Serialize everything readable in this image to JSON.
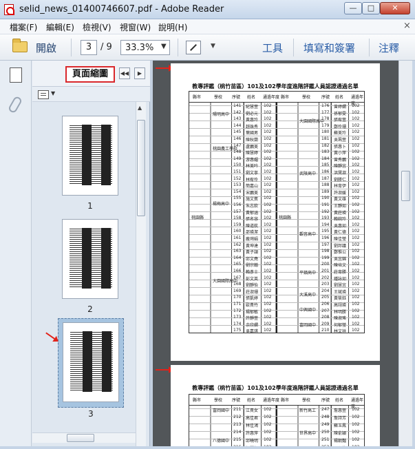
{
  "window": {
    "title": "selid_news_01400746607.pdf - Adobe Reader",
    "min": "—",
    "max": "□",
    "close": "✕"
  },
  "menu": [
    {
      "label": "檔案(F)"
    },
    {
      "label": "編輯(E)"
    },
    {
      "label": "檢視(V)"
    },
    {
      "label": "視窗(W)"
    },
    {
      "label": "說明(H)"
    }
  ],
  "menu_close": "×",
  "toolbar": {
    "open_label": "開啟",
    "page_value": "3",
    "page_total": "/ 9",
    "zoom_value": "33.3%",
    "zoom_arrow": "▼",
    "more_arrow": "▼",
    "tools_label": "工具",
    "fill_sign_label": "填寫和簽署",
    "comment_label": "注釋"
  },
  "panel": {
    "title": "頁面縮圖",
    "prev": "◀◀",
    "next": "▶",
    "options_arrow": "▼",
    "thumbnails": [
      {
        "label": "1"
      },
      {
        "label": "2"
      },
      {
        "label": "3"
      }
    ],
    "scroll_up": "▲",
    "scroll_down": "▼"
  },
  "document": {
    "page_title": "教專評鑑（桃竹苗區）101及102學年度進階評鑑人員認證通過名單",
    "headers": [
      "縣市",
      "學校",
      "序號",
      "姓名",
      "通過年度",
      "縣市",
      "學校",
      "序號",
      "姓名",
      "通過年度"
    ],
    "left_county": "桃園縣",
    "right_county": "桃園縣",
    "left_schools": [
      "陽明高中",
      "桃園農工學校",
      "楊梅高中",
      "大園國際高中"
    ],
    "right_schools": [
      "大園國際高中",
      "武陵高中",
      "觀音高中",
      "平鎮高中",
      "大溪高中",
      "中興國中",
      "富岡國中"
    ],
    "left_numbers": [
      "141",
      "142",
      "143",
      "144",
      "145",
      "146",
      "147",
      "148",
      "149",
      "150",
      "151",
      "152",
      "153",
      "154",
      "155",
      "156",
      "157",
      "158",
      "159",
      "160",
      "161",
      "162",
      "163",
      "164",
      "165",
      "166",
      "167",
      "168",
      "169",
      "170",
      "171",
      "172",
      "173",
      "174",
      "175"
    ],
    "left_names": [
      "紀慧萱",
      "劉必元",
      "黃惠玲",
      "趙珠秀",
      "葉國男",
      "陳秋蘭",
      "盧鵬美",
      "陳慧婷",
      "游惠媚",
      "林美吟",
      "劉文寧",
      "林宥伶",
      "簡嘉山",
      "宋鵬美",
      "施文賓",
      "朱志欽",
      "黃郁涵",
      "張名容",
      "陳道航",
      "邵瑛潔",
      "龐琍娟",
      "黃坤達",
      "黃子頡",
      "邱文堯",
      "劉宗翰",
      "賴彥士",
      "彭文英",
      "劉靜怡",
      "莊淑珊",
      "張凱婷",
      "歐貴竹",
      "楊郁敏",
      "許靜萱",
      "余欣嫻",
      "吳嘉琪"
    ],
    "right_numbers": [
      "176",
      "177",
      "178",
      "179",
      "180",
      "181",
      "182",
      "183",
      "184",
      "185",
      "186",
      "187",
      "188",
      "189",
      "190",
      "191",
      "192",
      "193",
      "194",
      "195",
      "196",
      "197",
      "198",
      "199",
      "200",
      "201",
      "202",
      "203",
      "204",
      "205",
      "206",
      "207",
      "208",
      "209",
      "210"
    ],
    "right_names": [
      "曾婷嫻",
      "孫郁雯",
      "張宥萱",
      "鄭伶珊",
      "蘇美玲",
      "吳珮萱",
      "張惠卜",
      "黃小萍",
      "曾秀鵬",
      "陳靜宜",
      "洪賢淑",
      "劉勝仁",
      "林育伊",
      "許淑媛",
      "黃文雄",
      "王靜如",
      "黃莊瑛",
      "賴婉玲",
      "吳惠如",
      "黃仁德",
      "陳佳瑩",
      "劉邦議",
      "鄭惟公",
      "吳宜錦",
      "陳培文",
      "莊育勝",
      "鍾詠如",
      "劉慧宜",
      "王斌瑛",
      "黃筱鈺",
      "高翊瑛",
      "林明勝",
      "陳淑瑤",
      "何郁瑩",
      "林文祥"
    ],
    "year": "102",
    "page2_title": "教專評鑑（桃竹苗區）101及102學年度進階評鑑人員認證通過名單",
    "page2_rows": [
      {
        "school": "富岡國中",
        "num": "211",
        "name": "江貴女",
        "year": "102",
        "rschool": "新竹高工",
        "rnum": "247",
        "rname": "詹惠萱",
        "ryear": "102"
      },
      {
        "school": "",
        "num": "212",
        "name": "高佳君",
        "year": "102",
        "rschool": "",
        "rnum": "248",
        "rname": "詹詩芳",
        "ryear": "102"
      },
      {
        "school": "",
        "num": "213",
        "name": "林佳鴻",
        "year": "102",
        "rschool": "",
        "rnum": "249",
        "rname": "蘇玉鳳",
        "ryear": "102"
      },
      {
        "school": "",
        "num": "214",
        "name": "許惠萍",
        "year": "102",
        "rschool": "世界高中",
        "rnum": "250",
        "rname": "陳俞穎",
        "ryear": "102"
      },
      {
        "school": "八德國中",
        "num": "215",
        "name": "邱曉明",
        "year": "102",
        "rschool": "",
        "rnum": "251",
        "rname": "楊朝豔",
        "ryear": "102"
      },
      {
        "school": "",
        "num": "216",
        "name": "郭麗仁",
        "year": "102",
        "rschool": "",
        "rnum": "252",
        "rname": "張心怡",
        "ryear": "102"
      }
    ]
  }
}
